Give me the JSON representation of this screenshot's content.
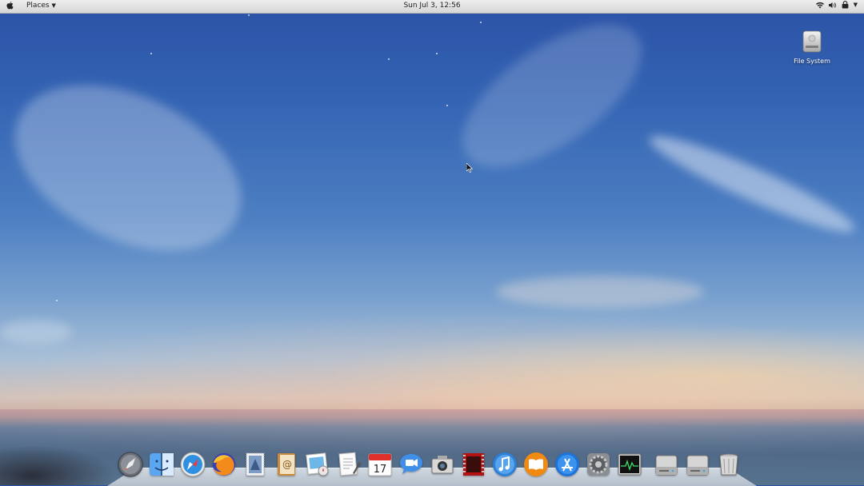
{
  "topbar": {
    "apple_menu_icon": "apple-icon",
    "places_label": "Places",
    "clock": "Sun Jul  3, 12:56",
    "tray_icons": [
      "wifi-icon",
      "volume-icon",
      "user-icon"
    ]
  },
  "desktop": {
    "icons": [
      {
        "name": "harddrive-icon",
        "label": "File System"
      }
    ]
  },
  "dock": {
    "apps": [
      {
        "id": "launchpad",
        "icon": "rocket-icon"
      },
      {
        "id": "finder",
        "icon": "finder-icon"
      },
      {
        "id": "safari",
        "icon": "compass-icon"
      },
      {
        "id": "firefox",
        "icon": "firefox-icon"
      },
      {
        "id": "mail",
        "icon": "stamp-icon"
      },
      {
        "id": "contacts",
        "icon": "address-book-icon"
      },
      {
        "id": "preview",
        "icon": "photos-icon"
      },
      {
        "id": "textedit",
        "icon": "document-icon"
      },
      {
        "id": "calendar",
        "icon": "calendar-icon",
        "badge_text": "17"
      },
      {
        "id": "facetime",
        "icon": "video-camera-icon"
      },
      {
        "id": "screenshot",
        "icon": "camera-icon"
      },
      {
        "id": "photo-booth",
        "icon": "film-icon"
      },
      {
        "id": "itunes",
        "icon": "music-note-icon"
      },
      {
        "id": "ibooks",
        "icon": "book-icon"
      },
      {
        "id": "app-store",
        "icon": "app-store-icon"
      },
      {
        "id": "system-preferences",
        "icon": "gear-icon"
      },
      {
        "id": "activity-monitor",
        "icon": "activity-monitor-icon"
      },
      {
        "id": "drive-1",
        "icon": "harddrive-icon"
      },
      {
        "id": "drive-2",
        "icon": "harddrive-icon"
      },
      {
        "id": "trash",
        "icon": "trash-icon"
      }
    ]
  },
  "colors": {
    "topbar_bg": "#e4e4e4",
    "sky_top": "#2b52a6",
    "horizon": "#d3c3bb"
  }
}
